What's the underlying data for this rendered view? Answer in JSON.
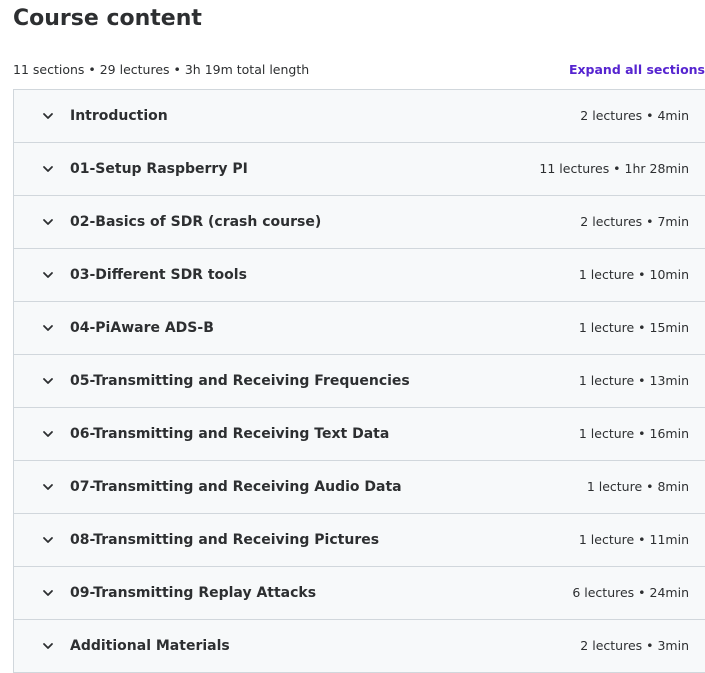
{
  "header": {
    "title": "Course content",
    "summary": "11 sections • 29 lectures • 3h 19m total length",
    "expand_label": "Expand all sections"
  },
  "colors": {
    "accent": "#5624d0",
    "row_background": "#f7f9fa",
    "border": "#d1d7dc",
    "text": "#2d2f31"
  },
  "sections": [
    {
      "title": "Introduction",
      "meta": "2 lectures • 4min",
      "icon": "chevron-down-icon"
    },
    {
      "title": "01-Setup Raspberry PI",
      "meta": "11 lectures • 1hr 28min",
      "icon": "chevron-down-icon"
    },
    {
      "title": "02-Basics of SDR (crash course)",
      "meta": "2 lectures • 7min",
      "icon": "chevron-down-icon"
    },
    {
      "title": "03-Different SDR tools",
      "meta": "1 lecture • 10min",
      "icon": "chevron-down-icon"
    },
    {
      "title": "04-PiAware ADS-B",
      "meta": "1 lecture • 15min",
      "icon": "chevron-down-icon"
    },
    {
      "title": "05-Transmitting and Receiving Frequencies",
      "meta": "1 lecture • 13min",
      "icon": "chevron-down-icon"
    },
    {
      "title": "06-Transmitting and Receiving Text Data",
      "meta": "1 lecture • 16min",
      "icon": "chevron-down-icon"
    },
    {
      "title": "07-Transmitting and Receiving Audio Data",
      "meta": "1 lecture • 8min",
      "icon": "chevron-down-icon"
    },
    {
      "title": "08-Transmitting and Receiving Pictures",
      "meta": "1 lecture • 11min",
      "icon": "chevron-down-icon"
    },
    {
      "title": "09-Transmitting Replay Attacks",
      "meta": "6 lectures • 24min",
      "icon": "chevron-down-icon"
    },
    {
      "title": "Additional Materials",
      "meta": "2 lectures • 3min",
      "icon": "chevron-down-icon"
    }
  ]
}
